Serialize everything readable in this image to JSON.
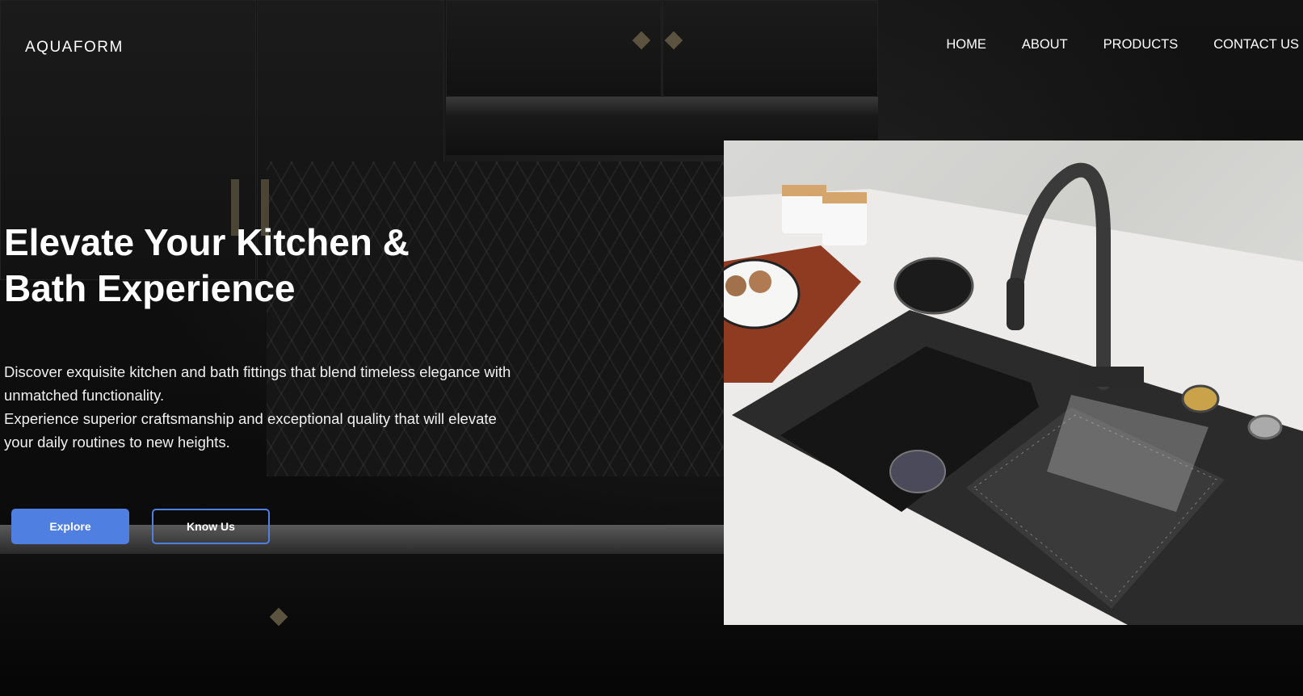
{
  "brand": {
    "logo": "AQUAFORM"
  },
  "nav": {
    "items": [
      {
        "label": "HOME"
      },
      {
        "label": "ABOUT"
      },
      {
        "label": "PRODUCTS"
      },
      {
        "label": "CONTACT US"
      }
    ]
  },
  "hero": {
    "title_line1": "Elevate Your Kitchen &",
    "title_line2": "Bath Experience",
    "desc_line1": "Discover exquisite kitchen and bath fittings that blend timeless elegance with",
    "desc_line2": "unmatched functionality.",
    "desc_line3": "Experience superior craftsmanship and exceptional quality that will elevate",
    "desc_line4": "your daily routines to new heights."
  },
  "buttons": {
    "explore_label": "Explore",
    "know_label": "Know Us"
  },
  "colors": {
    "accent": "#4f7fe0",
    "background": "#0a0a0a",
    "text": "#ffffff"
  },
  "images": {
    "background": "dark-kitchen-scene",
    "product": "black-sink-with-pull-down-faucet"
  }
}
